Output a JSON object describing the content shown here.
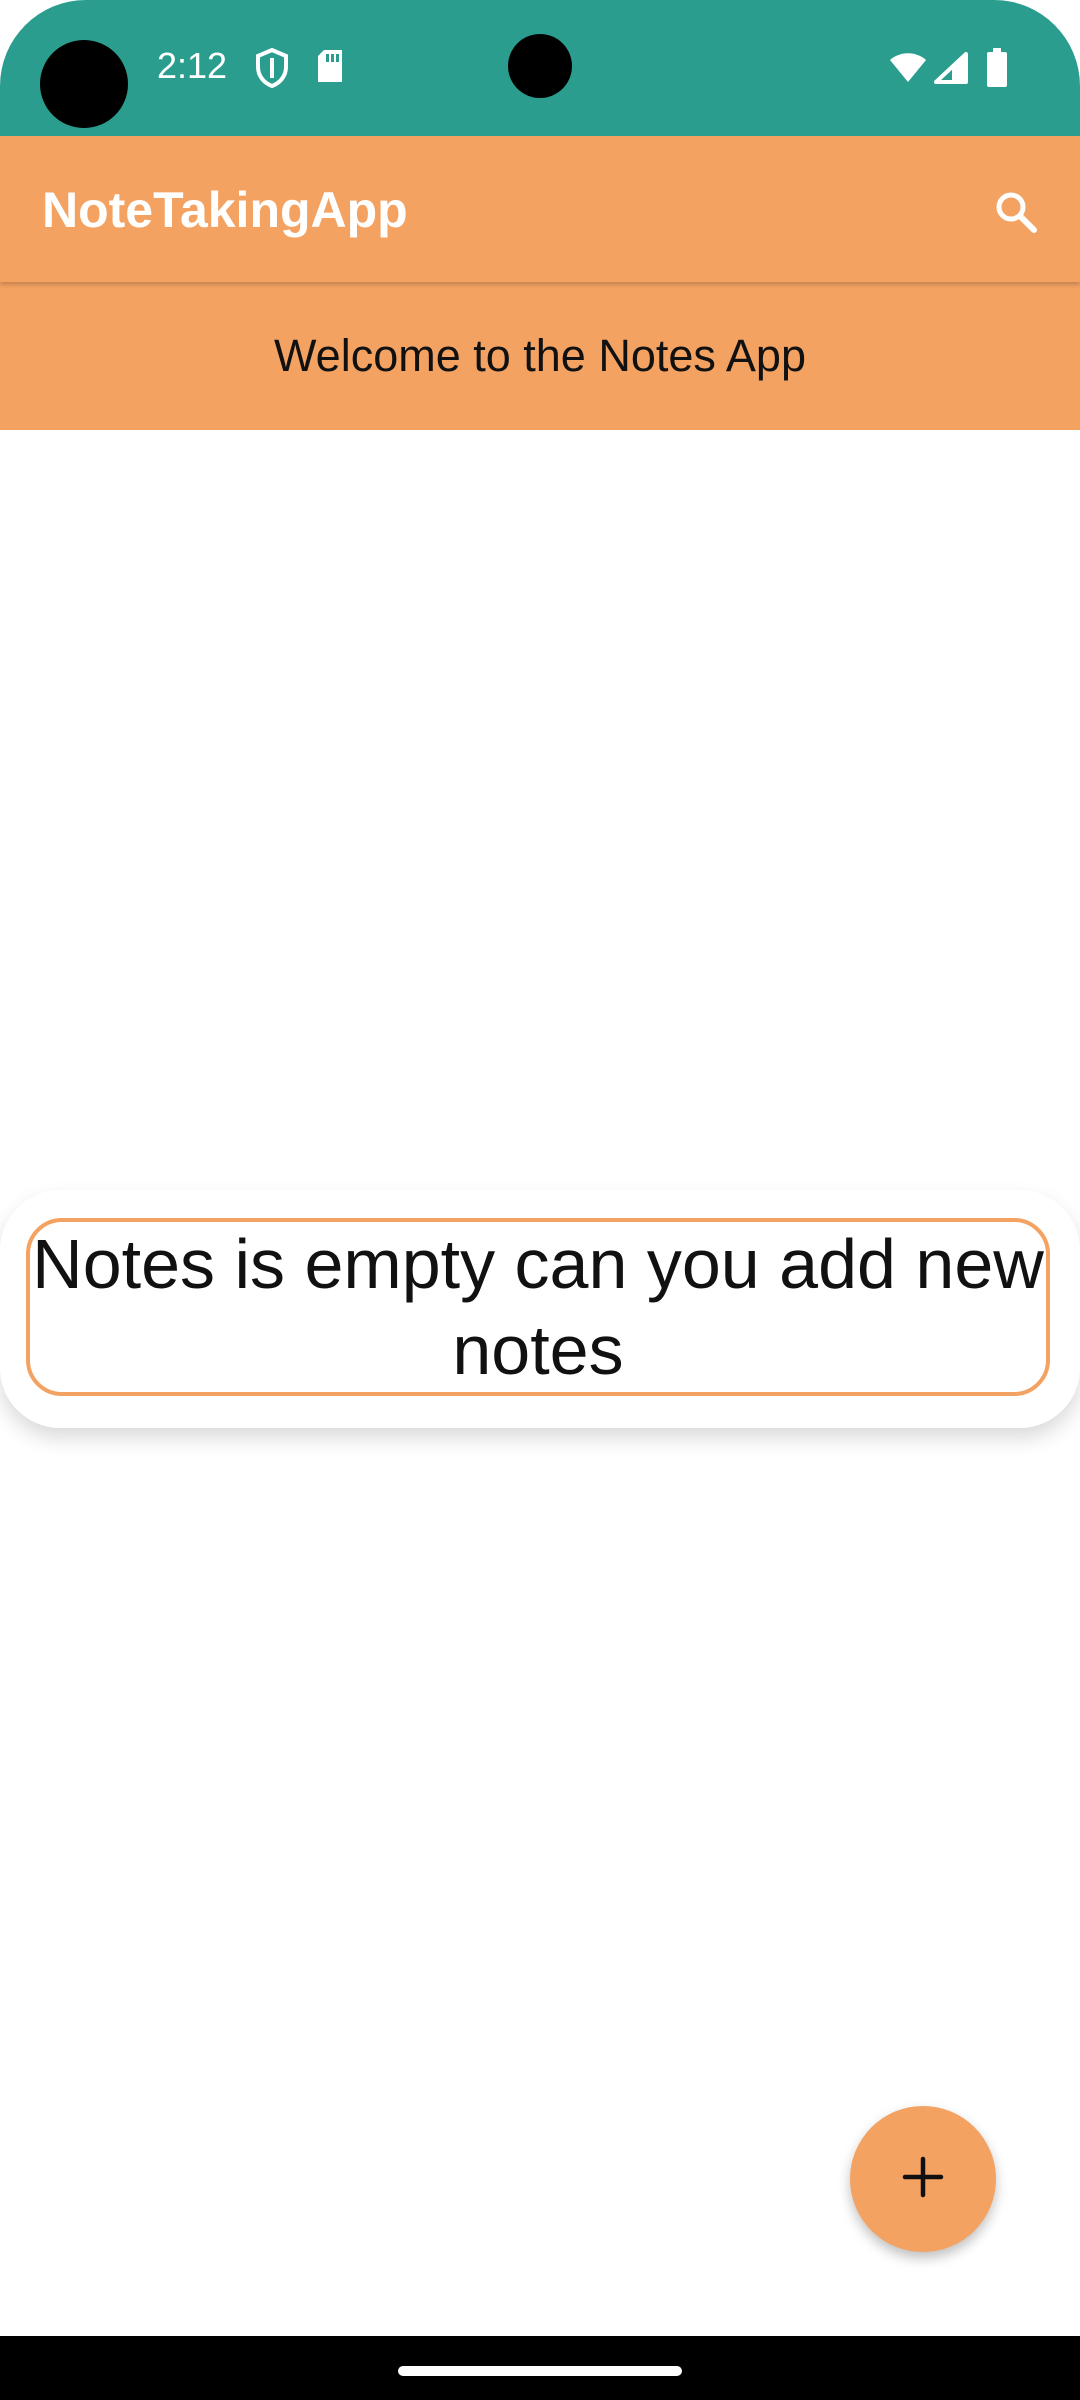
{
  "status_bar": {
    "time": "2:12",
    "icons": [
      "shield-icon",
      "sd-card-icon",
      "wifi-icon",
      "cell-signal-icon",
      "battery-icon"
    ]
  },
  "app_bar": {
    "title": "NoteTakingApp",
    "search_icon": "search-icon"
  },
  "welcome": {
    "text": "Welcome to the Notes App"
  },
  "empty_state": {
    "message": "Notes is empty can you add new notes"
  },
  "fab": {
    "icon": "plus-icon"
  },
  "colors": {
    "status_bar": "#2a9d8f",
    "accent": "#f4a261",
    "background": "#ffffff"
  }
}
